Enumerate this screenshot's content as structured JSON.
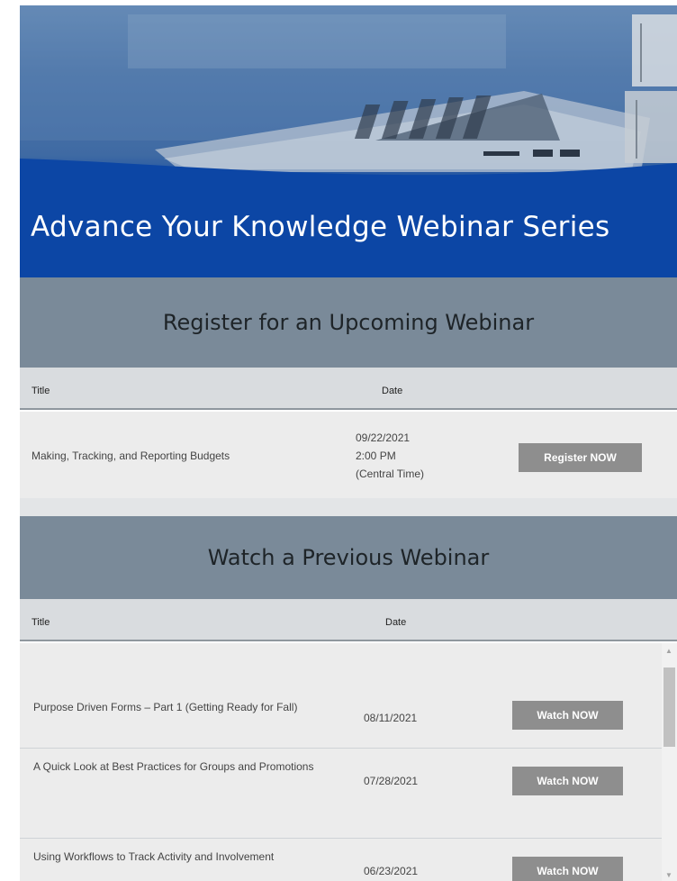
{
  "hero": {
    "title": "Advance Your Knowledge Webinar Series"
  },
  "upcoming": {
    "heading": "Register for an Upcoming Webinar",
    "columns": {
      "title": "Title",
      "date": "Date"
    },
    "rows": [
      {
        "title": "Making, Tracking, and Reporting Budgets",
        "date_line1": "09/22/2021",
        "date_line2": "2:00 PM",
        "date_line3": "(Central Time)",
        "button": "Register NOW"
      }
    ]
  },
  "previous": {
    "heading": "Watch a Previous Webinar",
    "columns": {
      "title": "Title",
      "date": "Date"
    },
    "rows": [
      {
        "title": "Purpose Driven Forms – Part 1 (Getting Ready for Fall)",
        "date": "08/11/2021",
        "button": "Watch NOW"
      },
      {
        "title": "A Quick Look at Best Practices for Groups and Promotions",
        "date": "07/28/2021",
        "button": "Watch NOW"
      },
      {
        "title": "Using Workflows to Track Activity and Involvement",
        "date": "06/23/2021",
        "button": "Watch NOW"
      }
    ]
  },
  "scrollbar": {
    "up_icon": "triangle-up-icon",
    "down_icon": "triangle-down-icon"
  },
  "colors": {
    "banner_blue": "#0a44a6",
    "section_gray": "#7a8a99",
    "button_gray": "#8e8e8e"
  }
}
